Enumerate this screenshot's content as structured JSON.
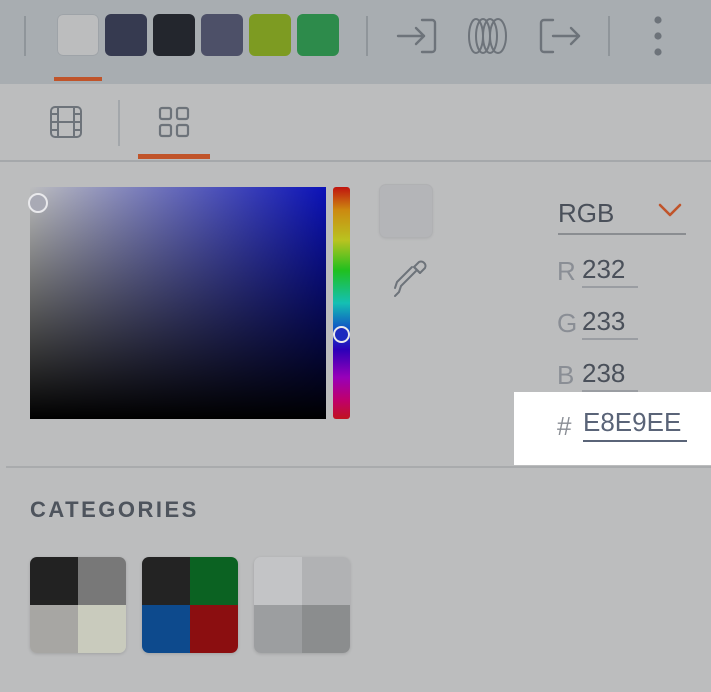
{
  "toolbar": {
    "swatches": [
      {
        "name": "swatch-light-gray",
        "color": "#bcbdbe",
        "selected": true
      },
      {
        "name": "swatch-navy-gray",
        "color": "#363a50"
      },
      {
        "name": "swatch-charcoal",
        "color": "#23262d"
      },
      {
        "name": "swatch-slate",
        "color": "#4d5068"
      },
      {
        "name": "swatch-olive",
        "color": "#7d9b22"
      },
      {
        "name": "swatch-green",
        "color": "#2d8b4b"
      }
    ],
    "icons": [
      "sign-in-icon",
      "rings-icon",
      "sign-out-icon",
      "more-vertical-icon"
    ]
  },
  "view_tabs": {
    "icons": [
      "film-grid-icon",
      "grid-icon"
    ],
    "active": "grid-icon"
  },
  "picker": {
    "mode": "RGB",
    "channels": [
      {
        "letter": "R",
        "value": "232"
      },
      {
        "letter": "G",
        "value": "233"
      },
      {
        "letter": "B",
        "value": "238"
      }
    ],
    "hex_symbol": "#",
    "hex": "E8E9EE"
  },
  "categories": {
    "title": "CATEGORIES",
    "palettes": [
      [
        "#222222",
        "#787878",
        "#a7a6a3",
        "#c9cbbd"
      ],
      [
        "#232323",
        "#0b6222",
        "#0d4a8d",
        "#8b0e10"
      ],
      [
        "#c3c4c6",
        "#b1b2b4",
        "#9c9ea0",
        "#8b8d8e"
      ]
    ]
  },
  "accent_color": "#c0542a"
}
